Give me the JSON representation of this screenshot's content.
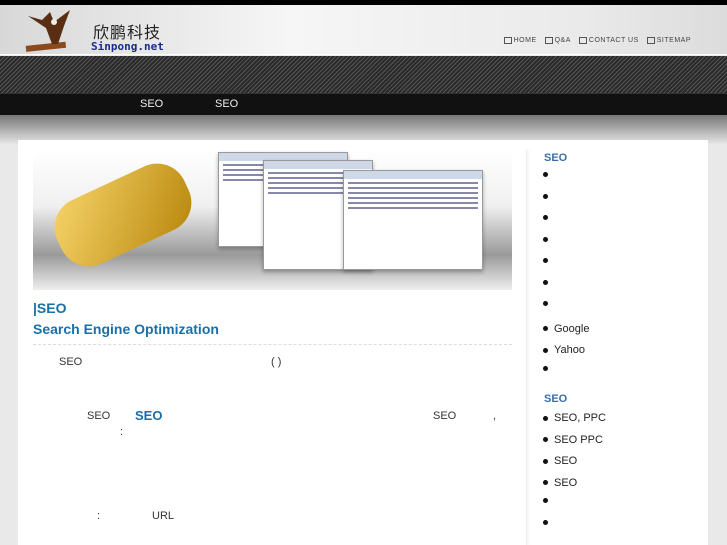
{
  "header": {
    "brand_cn": "欣鹏科技",
    "brand_en": "Sinpong.net",
    "links": [
      "HOME",
      "Q&A",
      "CONTACT US",
      "SITEMAP"
    ]
  },
  "nav": [
    "SEO",
    "SEO"
  ],
  "main": {
    "title1": "|SEO",
    "title2": "Search Engine Optimization",
    "p1_a": "SEO",
    "p1_b": "(    )",
    "p2_a": "SEO",
    "p2_b": "SEO",
    "p2_c": "SEO",
    "p2_d": ",",
    "p2_e": ":",
    "p3_a": ":",
    "p3_b": "URL"
  },
  "sidebar": {
    "heading1": "SEO",
    "list1": [
      "",
      "",
      "",
      "",
      "",
      "",
      "",
      "Google",
      "Yahoo",
      ""
    ],
    "heading2": "SEO",
    "list2": [
      "SEO,   PPC",
      "SEO PPC",
      "  SEO",
      "SEO",
      "",
      ""
    ]
  }
}
